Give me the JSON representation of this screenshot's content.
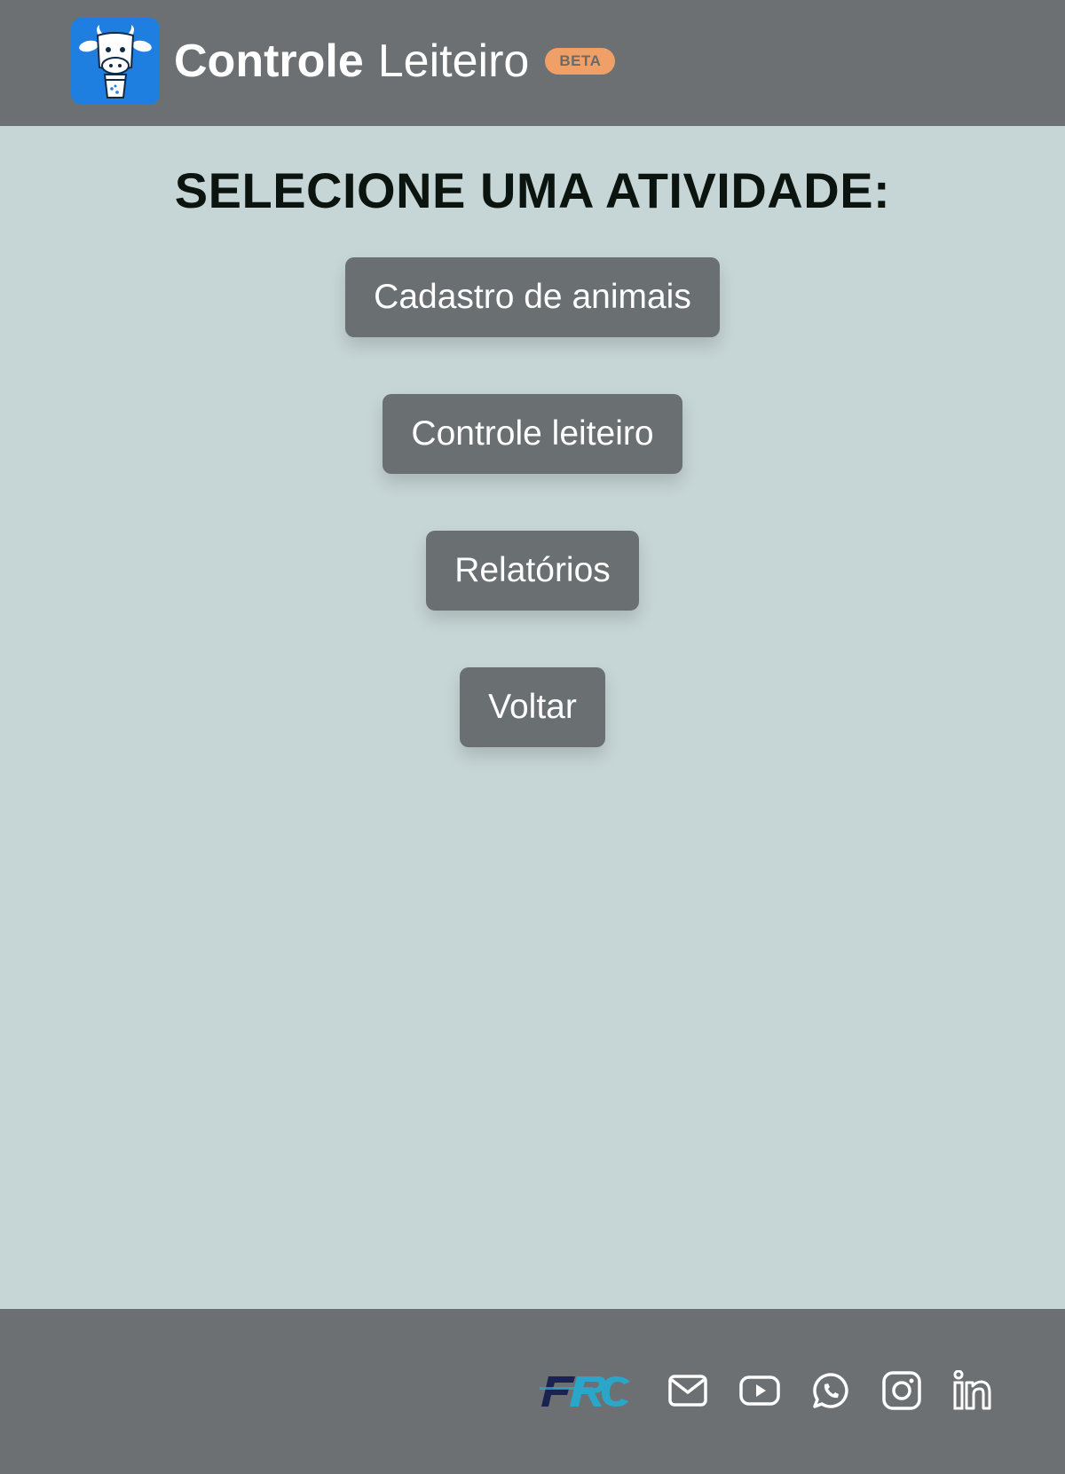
{
  "header": {
    "brand_bold": "Controle",
    "brand_light": "Leiteiro",
    "badge": "BETA",
    "logo_icon": "cow-milk-logo-icon"
  },
  "main": {
    "title": "SELECIONE UMA ATIVIDADE:",
    "buttons": [
      {
        "label": "Cadastro de animais"
      },
      {
        "label": "Controle leiteiro"
      },
      {
        "label": "Relatórios"
      },
      {
        "label": "Voltar"
      }
    ]
  },
  "footer": {
    "logo_icon": "frc-logo-icon",
    "social_icons": [
      "mail-icon",
      "youtube-icon",
      "whatsapp-icon",
      "instagram-icon",
      "linkedin-icon"
    ]
  },
  "colors": {
    "header_bg": "#6c7073",
    "page_bg": "#c6d5d5",
    "button_bg": "#6a6f72",
    "logo_bg": "#1f7fe0",
    "badge_bg": "#f0a066"
  }
}
